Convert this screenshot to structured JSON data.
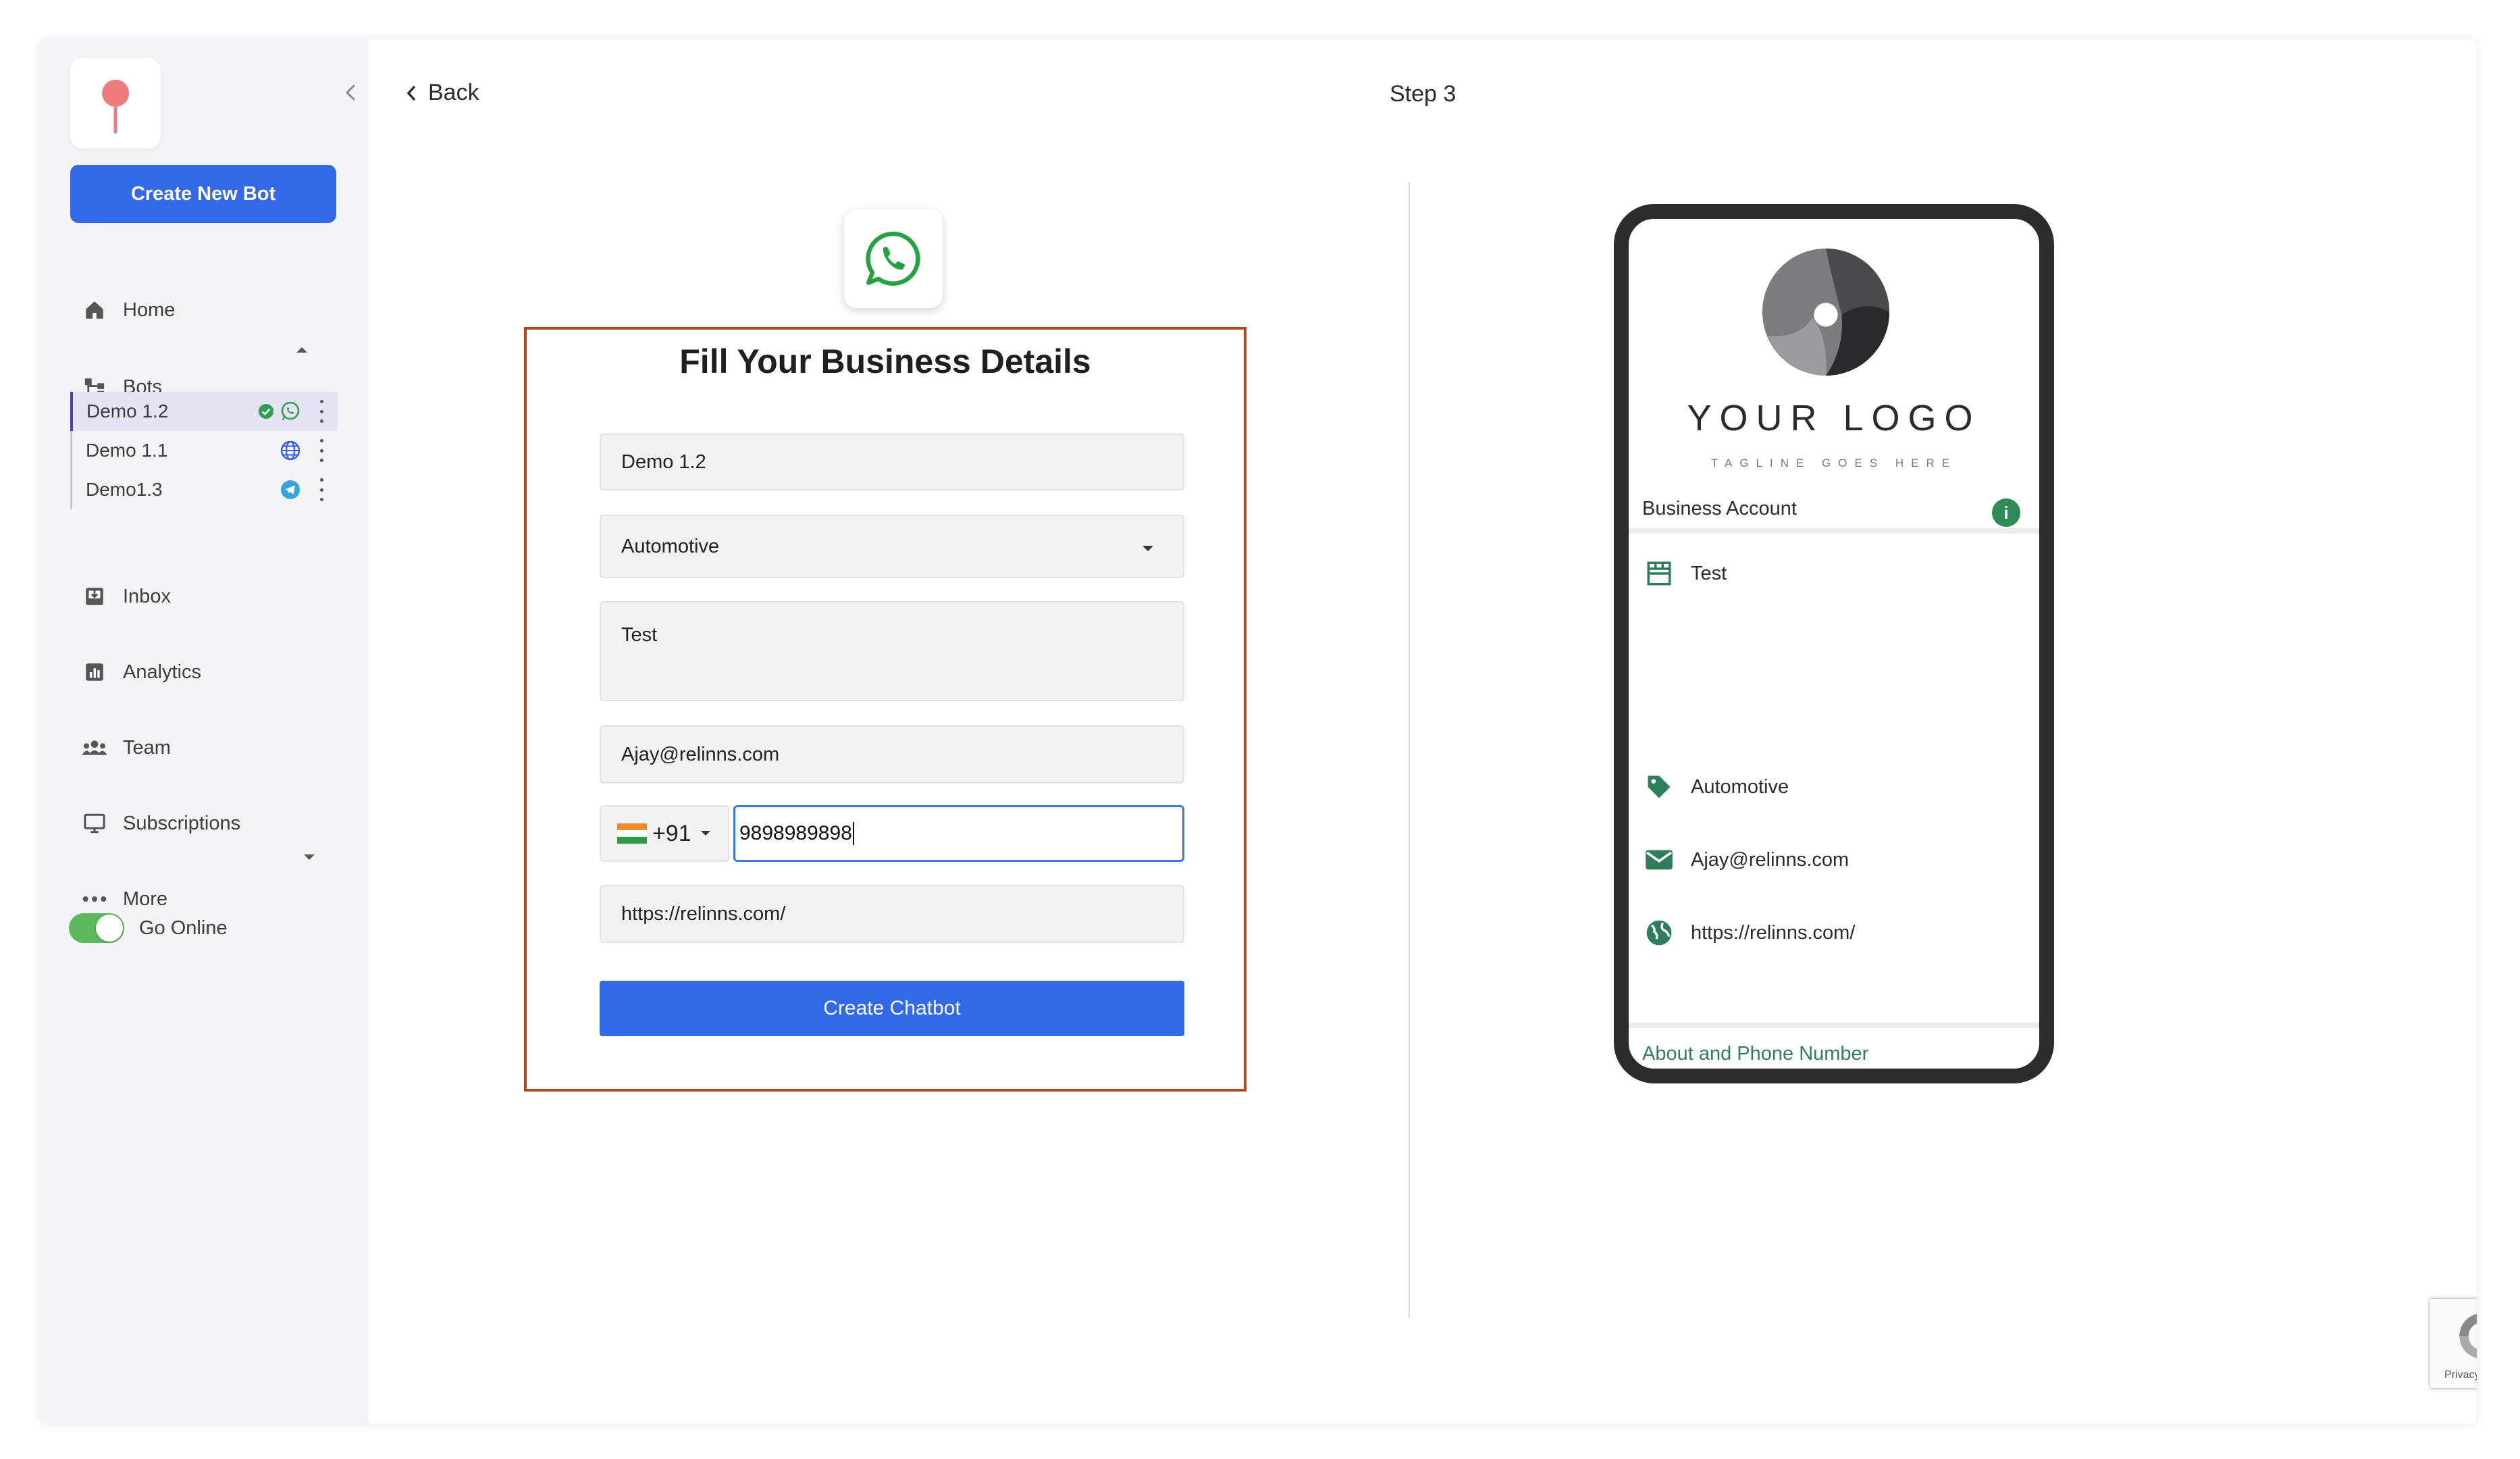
{
  "sidebar": {
    "create_button": "Create New Bot",
    "nav": {
      "home": "Home",
      "bots": "Bots",
      "inbox": "Inbox",
      "analytics": "Analytics",
      "team": "Team",
      "subscriptions": "Subscriptions",
      "more": "More"
    },
    "bots": [
      {
        "name": "Demo 1.2",
        "channel": "whatsapp-icon",
        "verified": true,
        "active": true
      },
      {
        "name": "Demo 1.1",
        "channel": "globe-icon",
        "verified": false,
        "active": false
      },
      {
        "name": "Demo1.3",
        "channel": "telegram-icon",
        "verified": false,
        "active": false
      }
    ],
    "go_online": {
      "label": "Go Online",
      "on": true
    }
  },
  "header": {
    "back_label": "Back",
    "step_label": "Step 3"
  },
  "form": {
    "title": "Fill Your Business Details",
    "business_name": "Demo 1.2",
    "category": "Automotive",
    "description": "Test",
    "email": "Ajay@relinns.com",
    "country_code": "+91",
    "phone": "9898989898",
    "website": "https://relinns.com/",
    "submit_label": "Create Chatbot"
  },
  "preview": {
    "logo_text": "YOUR LOGO",
    "tagline": "TAGLINE GOES HERE",
    "account_label": "Business Account",
    "description": "Test",
    "category": "Automotive",
    "email": "Ajay@relinns.com",
    "website": "https://relinns.com/",
    "footer_link": "About and Phone Number"
  },
  "recaptcha": {
    "label": "Privacy - Terms"
  },
  "colors": {
    "primary": "#3369e7",
    "form_border": "#b3461e",
    "whatsapp": "#25a244",
    "accent_green": "#2e8b57"
  }
}
